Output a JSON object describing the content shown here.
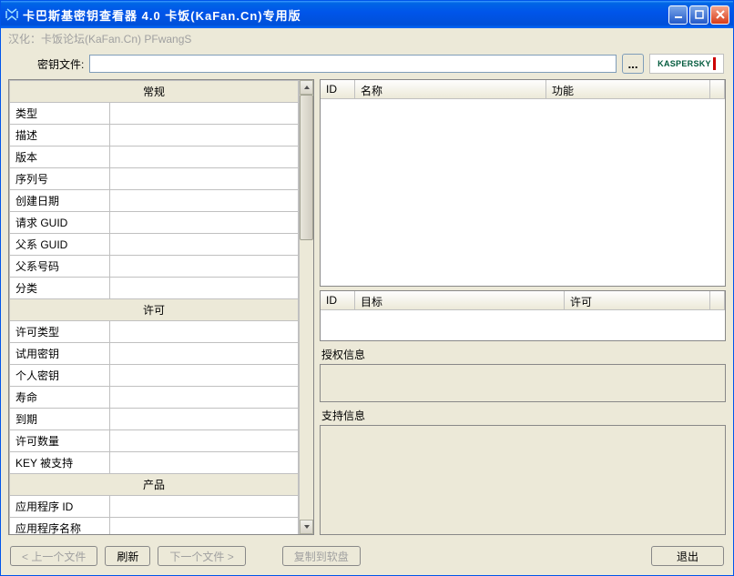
{
  "window": {
    "title": "卡巴斯基密钥查看器 4.0 卡饭(KaFan.Cn)专用版",
    "subtitle": "汉化：卡饭论坛(KaFan.Cn) PFwangS"
  },
  "toolbar": {
    "keyfile_label": "密钥文件:",
    "keyfile_value": "",
    "browse_label": "...",
    "brand_text": "KASPERSKY"
  },
  "left_panel": {
    "sections": {
      "general": "常规",
      "license": "许可",
      "product": "产品"
    },
    "rows_general": [
      "类型",
      "描述",
      "版本",
      "序列号",
      "创建日期",
      "请求 GUID",
      "父系 GUID",
      "父系号码",
      "分类"
    ],
    "rows_license": [
      "许可类型",
      "试用密钥",
      "个人密钥",
      "寿命",
      "到期",
      "许可数量",
      "KEY 被支持"
    ],
    "rows_product": [
      "应用程序 ID",
      "应用程序名称"
    ]
  },
  "right_panel": {
    "grid1": {
      "col_id": "ID",
      "col_name": "名称",
      "col_func": "功能"
    },
    "grid2": {
      "col_id": "ID",
      "col_target": "目标",
      "col_license": "许可"
    },
    "auth_label": "授权信息",
    "support_label": "支持信息"
  },
  "bottom": {
    "prev": "< 上一个文件",
    "refresh": "刷新",
    "next": "下一个文件 >",
    "copy": "复制到软盘",
    "exit": "退出"
  }
}
